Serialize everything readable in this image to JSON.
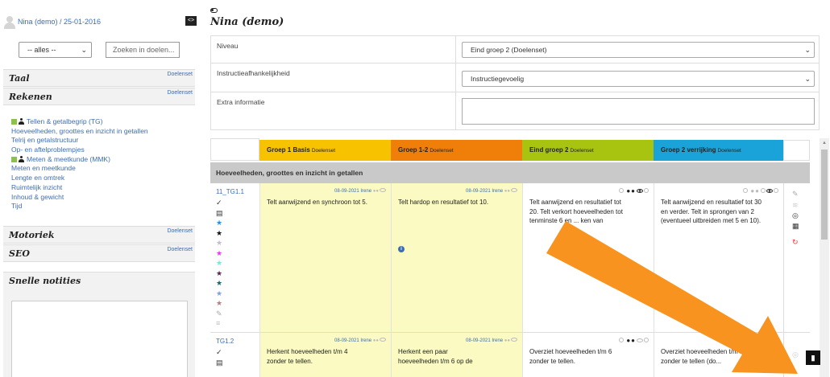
{
  "sidebar": {
    "user_title": "Nina (demo) / 25-01-2016",
    "collapse_label": "<>",
    "filter_select": "-- alles --",
    "search_placeholder": "Zoeken in doelen...",
    "categories": [
      {
        "name": "Taal",
        "tag": "Doelenset"
      },
      {
        "name": "Rekenen",
        "tag": "Doelenset"
      },
      {
        "name": "Motoriek",
        "tag": "Doelenset"
      },
      {
        "name": "SEO",
        "tag": "Doelenset"
      }
    ],
    "rekenen_items": [
      "Tellen & getalbegrip (TG)",
      "Hoeveelheden, groottes en inzicht in getallen",
      "Telrij en getalstructuur",
      "Op- en aftelproblempjes",
      "Meten & meetkunde (MMK)",
      "Meten en meetkunde",
      "Lengte en omtrek",
      "Ruimtelijk inzicht",
      "Inhoud & gewicht",
      "Tijd"
    ],
    "notes_title": "Snelle notities"
  },
  "main": {
    "title": "Nina (demo)",
    "form": {
      "niveau_label": "Niveau",
      "niveau_value": "Eind groep 2 (Doelenset)",
      "instructie_label": "Instructieafhankelijkheid",
      "instructie_value": "Instructiegevoelig",
      "extra_label": "Extra informatie"
    },
    "columns": [
      {
        "title": "Groep 1 Basis",
        "tag": "Doelenset",
        "color": "#f7c200"
      },
      {
        "title": "Groep 1-2",
        "tag": "Doelenset",
        "color": "#f07f09"
      },
      {
        "title": "Eind groep 2",
        "tag": "Doelenset",
        "color": "#a8c410"
      },
      {
        "title": "Groep 2 verrijking",
        "tag": "Doelenset",
        "color": "#1aa3d9"
      }
    ],
    "section": "Hoeveelheden, groottes en inzicht in getallen",
    "rows": [
      {
        "code": "11_TG1.1",
        "cells": [
          {
            "meta": "08-09-2021 Irene",
            "text": "Telt aanwijzend en synchroon tot 5."
          },
          {
            "meta": "08-09-2021 Irene",
            "text": "Telt hardop en resultatief tot 10."
          },
          {
            "text": "Telt aanwijzend en resultatief tot 20. Telt verkort hoeveelheden tot tenminste 6 en ... ken van"
          },
          {
            "text": "Telt aanwijzend en resultatief tot 30 en verder. Telt in sprongen van 2 (eventueel uitbreiden met 5 en 10)."
          }
        ]
      },
      {
        "code": "TG1.2",
        "cells": [
          {
            "meta": "08-09-2021 Irene",
            "text": "Herkent hoeveelheden t/m 4 zonder te tellen."
          },
          {
            "meta": "08-09-2021 Irene",
            "text": "Herkent een paar hoeveelheden t/m 6 op de"
          },
          {
            "text": "Overziet hoeveelheden t/m 6 zonder te tellen."
          },
          {
            "text": "Overziet hoeveelheden t/m 10 vlot, zonder te tellen (do..."
          }
        ]
      }
    ]
  },
  "colors": {
    "accent_orange": "#f7931e",
    "yellow_cell": "#fafac2",
    "link": "#3a6db5"
  }
}
